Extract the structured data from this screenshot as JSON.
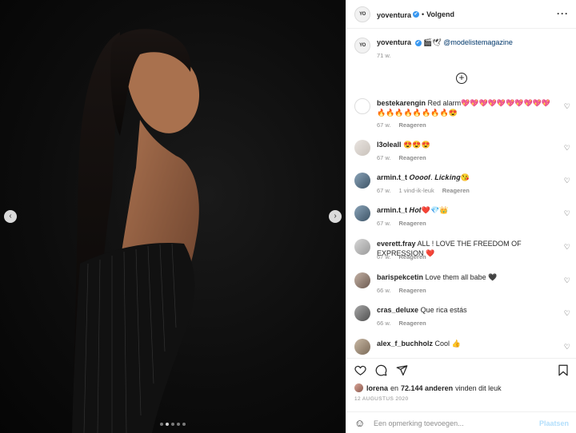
{
  "post": {
    "author": "yoventura",
    "follow_status": "Volgend",
    "separator": "•",
    "verified_mark": "✔",
    "caption": {
      "emoji": "🎬🕊",
      "mention": "@modelistemagazine",
      "time": "71 w."
    },
    "load_more_symbol": "+",
    "likes": {
      "liker": "lorena",
      "connector": "en",
      "count": "72.144 anderen",
      "suffix": "vinden dit leuk"
    },
    "date": "12 AUGUSTUS 2020",
    "add_comment_placeholder": "Een opmerking toevoegen...",
    "post_button": "Plaatsen",
    "carousel": {
      "total": 5,
      "active_index": 1
    }
  },
  "comments": [
    {
      "user": "bestekarengin",
      "text": "Red alarm💖💖💖💖💖💖💖💖💖💖🔥🔥🔥🔥🔥🔥🔥🔥😍",
      "time": "67 w.",
      "likes": "",
      "reply": "Reageren"
    },
    {
      "user": "l3oleall",
      "text": "😍😍😍",
      "time": "67 w.",
      "likes": "",
      "reply": "Reageren"
    },
    {
      "user": "armin.t_t",
      "text": "𝑶𝒐𝒐𝒐𝒇. 𝑳𝒊𝒄𝒌𝒊𝒏𝒈😘",
      "time": "67 w.",
      "likes": "1 vind-ik-leuk",
      "reply": "Reageren"
    },
    {
      "user": "armin.t_t",
      "text": "𝑯𝒐𝒕❤️💎👑",
      "time": "67 w.",
      "likes": "",
      "reply": "Reageren"
    },
    {
      "user": "everett.fray",
      "text": "ALL ! LOVE THE FREEDOM OF EXPRESSION ❤️",
      "time": "67 w.",
      "likes": "",
      "reply": "Reageren"
    },
    {
      "user": "barispekcetin",
      "text": "Love them all babe 🖤",
      "time": "66 w.",
      "likes": "",
      "reply": "Reageren"
    },
    {
      "user": "cras_deluxe",
      "text": "Que rica estás",
      "time": "66 w.",
      "likes": "",
      "reply": "Reageren"
    },
    {
      "user": "alex_f_buchholz",
      "text": "Cool 👍",
      "time": "",
      "likes": "",
      "reply": ""
    }
  ],
  "icons": {
    "more": "more-icon",
    "like": "heart-icon",
    "comment": "comment-icon",
    "share": "share-icon",
    "save": "bookmark-icon",
    "emoji": "smiley-icon",
    "prev": "chevron-left-icon",
    "next": "chevron-right-icon"
  },
  "colors": {
    "link": "#00376b",
    "muted": "#8e8e8e",
    "verified": "#3897f0",
    "post_button": "#b2dffc"
  }
}
